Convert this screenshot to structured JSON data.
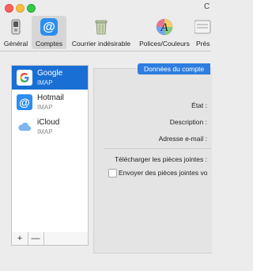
{
  "window": {
    "title_fragment": "C"
  },
  "toolbar": {
    "items": [
      {
        "label": "Général",
        "icon": "switch-icon"
      },
      {
        "label": "Comptes",
        "icon": "at-sign-icon",
        "selected": true
      },
      {
        "label": "Courrier indésirable",
        "icon": "trash-bin-icon"
      },
      {
        "label": "Polices/Couleurs",
        "icon": "font-colors-icon"
      },
      {
        "label": "Prés",
        "icon": "presentation-icon"
      }
    ]
  },
  "accounts": [
    {
      "name": "Google",
      "type": "IMAP",
      "icon": "google-icon",
      "selected": true
    },
    {
      "name": "Hotmail",
      "type": "IMAP",
      "icon": "at-sign-icon"
    },
    {
      "name": "iCloud",
      "type": "IMAP",
      "icon": "cloud-icon"
    }
  ],
  "list_buttons": {
    "add": "+",
    "remove": "—"
  },
  "detail": {
    "tab_label": "Données du compte",
    "fields": {
      "status": "État :",
      "description": "Description :",
      "email": "Adresse e-mail :",
      "download_attachments": "Télécharger les pièces jointes :"
    },
    "checkbox_label": "Envoyer des pièces jointes vo"
  },
  "colors": {
    "accent": "#1a6fd4",
    "tab": "#2e7de0"
  }
}
